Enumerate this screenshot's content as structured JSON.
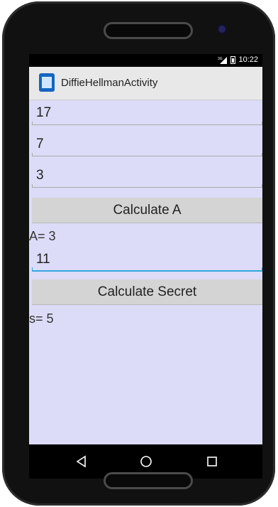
{
  "status_bar": {
    "network": "3G",
    "time": "10:22"
  },
  "action_bar": {
    "title": "DiffieHellmanActivity",
    "icon": "app-icon"
  },
  "form": {
    "field_1": {
      "value": "17"
    },
    "field_2": {
      "value": "7"
    },
    "field_3": {
      "value": "3"
    },
    "calculate_a_label": "Calculate A",
    "result_a": "A= 3",
    "field_4": {
      "value": "11"
    },
    "calculate_secret_label": "Calculate Secret",
    "result_secret": "s= 5"
  },
  "nav_bar": {
    "icons": [
      "back-icon",
      "home-icon",
      "recents-icon"
    ]
  },
  "colors": {
    "screen_background": "#dcdcf8",
    "action_bar": "#e8e8e8",
    "button": "#d4d4d4",
    "focus_underline": "#33a8dd",
    "phone_body": "#111111"
  }
}
